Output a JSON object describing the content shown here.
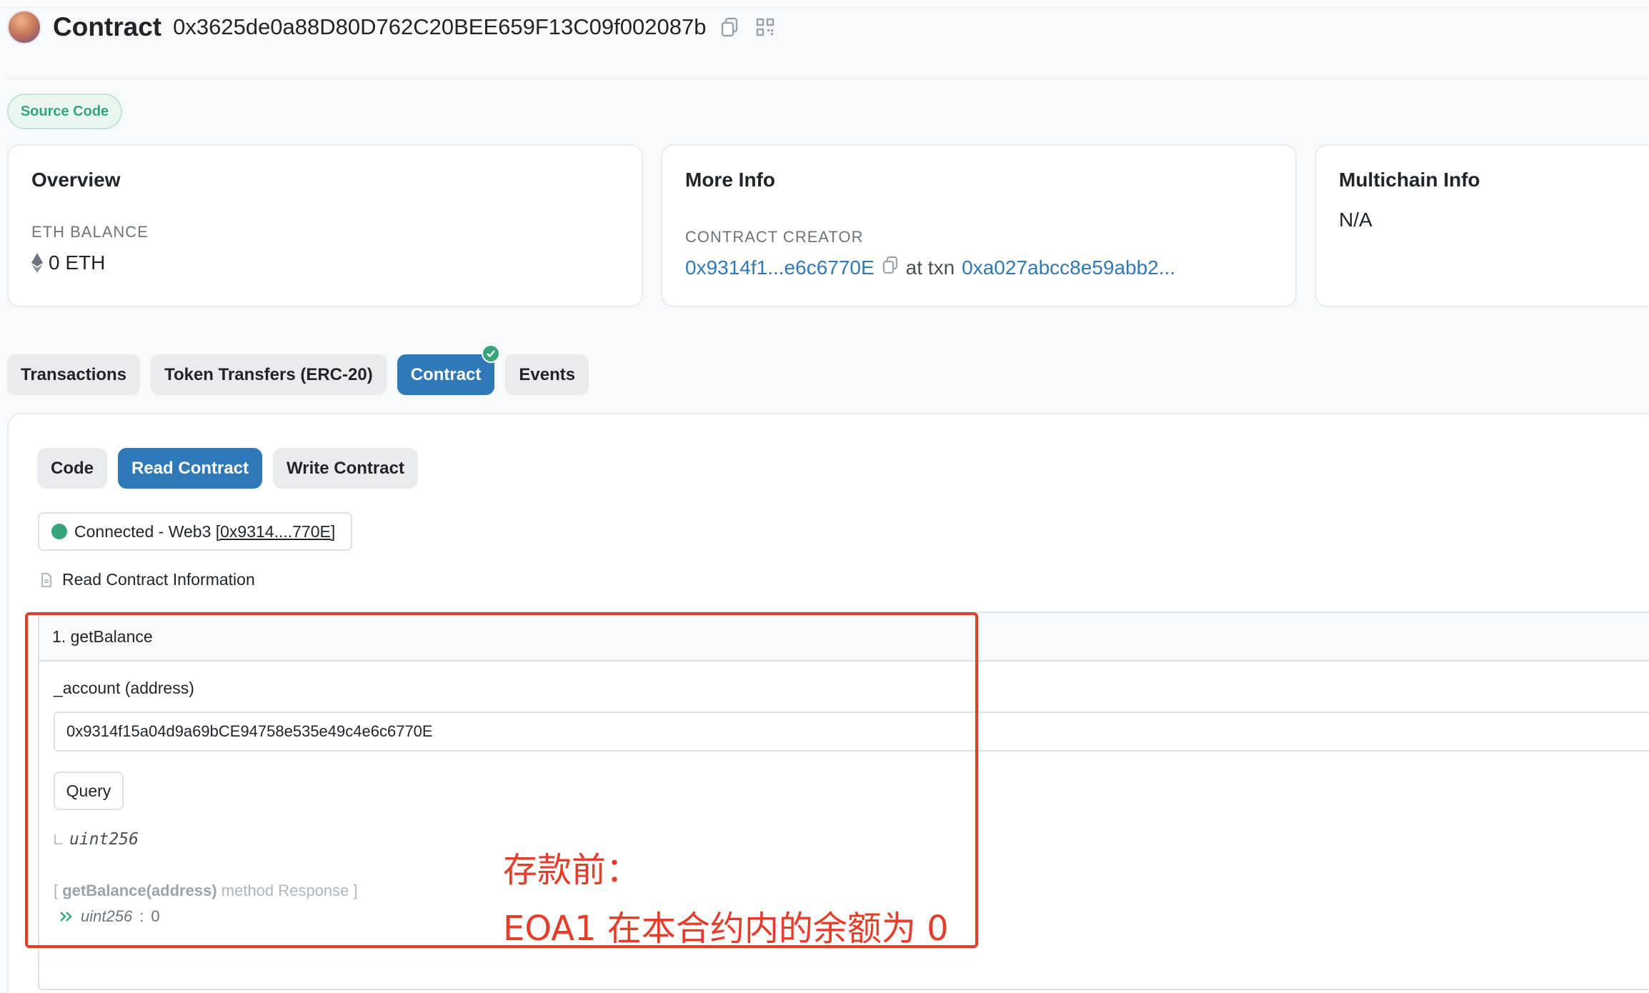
{
  "header": {
    "title": "Contract",
    "address": "0x3625de0a88D80D762C20BEE659F13C09f002087b"
  },
  "badge": {
    "label": "Source Code"
  },
  "overview": {
    "title": "Overview",
    "balance_label": "ETH BALANCE",
    "balance_value": "0 ETH"
  },
  "more_info": {
    "title": "More Info",
    "creator_label": "CONTRACT CREATOR",
    "creator_address": "0x9314f1...e6c6770E",
    "at_txn": "at txn",
    "txn_hash": "0xa027abcc8e59abb2..."
  },
  "multichain": {
    "title": "Multichain Info",
    "value": "N/A"
  },
  "tabs": [
    {
      "label": "Transactions"
    },
    {
      "label": "Token Transfers (ERC-20)"
    },
    {
      "label": "Contract"
    },
    {
      "label": "Events"
    }
  ],
  "subtabs": [
    {
      "label": "Code"
    },
    {
      "label": "Read Contract"
    },
    {
      "label": "Write Contract"
    }
  ],
  "connection": {
    "prefix": "Connected - Web3 ",
    "account": "[0x9314....770E]"
  },
  "read_info": {
    "label": "Read Contract Information"
  },
  "function": {
    "name": "1. getBalance",
    "param_label": "_account (address)",
    "param_value": "0x9314f15a04d9a69bCE94758e535e49c4e6c6770E",
    "query_label": "Query",
    "return_type": "uint256",
    "response_open": "[ ",
    "response_method": "getBalance(address)",
    "response_close": " method Response ]",
    "response_type": "uint256",
    "response_sep": " : ",
    "response_value": "0"
  },
  "annotation": {
    "line1": "存款前：",
    "line2": "EOA1 在本合约内的余额为 0",
    "color": "#e43d2a"
  },
  "colors": {
    "primary": "#2f79b8",
    "success": "#37a57b"
  }
}
